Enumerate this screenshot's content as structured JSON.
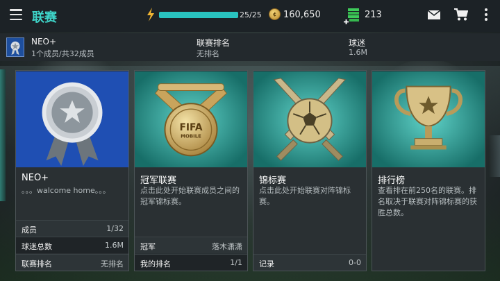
{
  "header": {
    "title": "联赛",
    "energy_text": "25/25",
    "energy_fraction": 1.0,
    "coins": "160,650",
    "coin_icon_text": "¢",
    "cash": "213",
    "icons": [
      "menu-icon",
      "energy-bolt-icon",
      "coin-icon",
      "cash-icon",
      "mail-icon",
      "cart-icon",
      "more-icon"
    ]
  },
  "league": {
    "name": "NEO+",
    "members": "1个成员/共32成员",
    "rank_label": "联赛排名",
    "rank_value": "无排名",
    "fans_label": "球迷",
    "fans_value": "1.6M"
  },
  "cards": {
    "my_league": {
      "title": "NEO+",
      "desc": "。。。walcome home。。。",
      "rows": [
        {
          "k": "成员",
          "v": "1/32"
        },
        {
          "k": "球迷总数",
          "v": "1.6M"
        },
        {
          "k": "联赛排名",
          "v": "无排名"
        }
      ]
    },
    "champions": {
      "title": "冠军联赛",
      "desc": "点击此处开始联赛成员之间的冠军锦标赛。",
      "medal_text": "FIFA",
      "medal_sub": "MOBILE",
      "rows": [
        {
          "k": "冠军",
          "v": "落木潇潇"
        },
        {
          "k": "我的排名",
          "v": "1/1"
        }
      ]
    },
    "tournament": {
      "title": "锦标赛",
      "desc": "点击此处开始联赛对阵锦标赛。",
      "rows": [
        {
          "k": "记录",
          "v": "0-0"
        }
      ]
    },
    "leaderboard": {
      "title": "排行榜",
      "desc": "查看排在前250名的联赛。排名取决于联赛对阵锦标赛的获胜总数。"
    }
  },
  "colors": {
    "accent": "#3ed4c8",
    "energy": "#29c3bf",
    "card_blue": "#1f4fb3",
    "card_teal": "#1e8a83"
  }
}
